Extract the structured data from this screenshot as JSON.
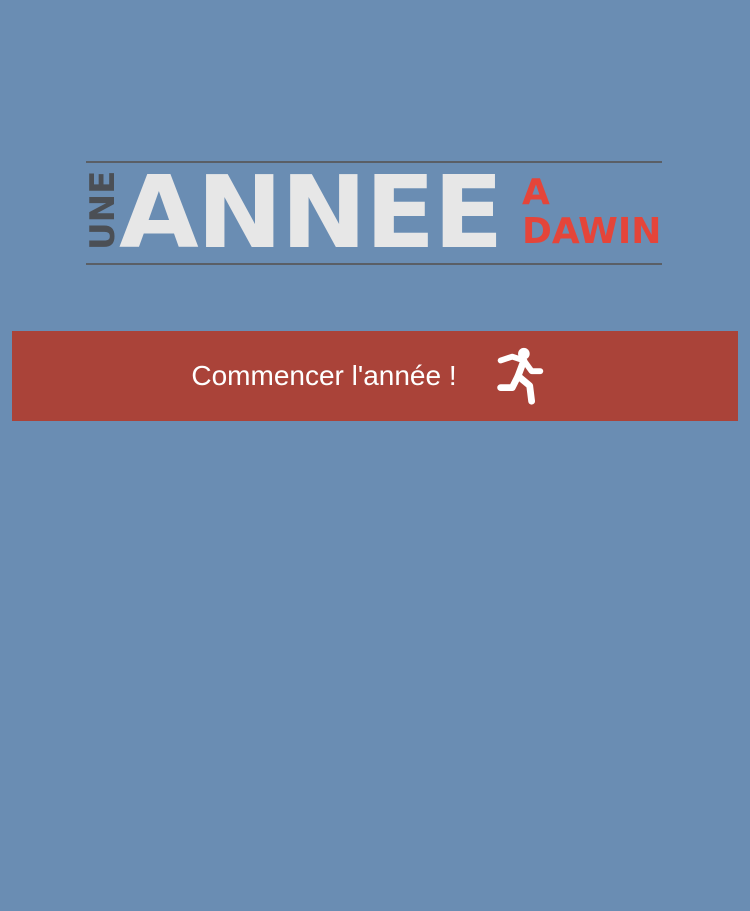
{
  "logo": {
    "une": "UNE",
    "annee": "ANNEE",
    "a": "A",
    "dawin": "DAWIN"
  },
  "start_button": {
    "label": "Commencer l'année !",
    "icon": "running-person-icon"
  },
  "colors": {
    "background": "#6a8db3",
    "button": "#aa4339",
    "logo_accent": "#e4453a",
    "logo_main": "#e7e7e7",
    "logo_dark": "#4b4f55"
  }
}
